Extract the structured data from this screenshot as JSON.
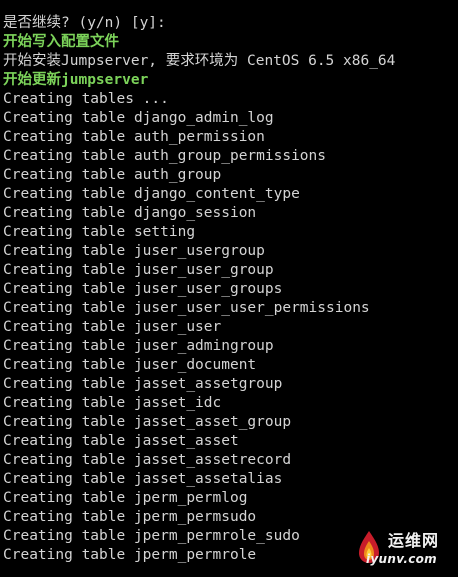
{
  "terminal": {
    "lines": [
      {
        "text": "是否继续? (y/n) [y]:",
        "style": "normal"
      },
      {
        "text": "开始写入配置文件",
        "style": "green"
      },
      {
        "text": "开始安装Jumpserver, 要求环境为 CentOS 6.5 x86_64",
        "style": "normal"
      },
      {
        "text": "开始更新jumpserver",
        "style": "green"
      },
      {
        "text": "Creating tables ...",
        "style": "normal"
      },
      {
        "text": "Creating table django_admin_log",
        "style": "normal"
      },
      {
        "text": "Creating table auth_permission",
        "style": "normal"
      },
      {
        "text": "Creating table auth_group_permissions",
        "style": "normal"
      },
      {
        "text": "Creating table auth_group",
        "style": "normal"
      },
      {
        "text": "Creating table django_content_type",
        "style": "normal"
      },
      {
        "text": "Creating table django_session",
        "style": "normal"
      },
      {
        "text": "Creating table setting",
        "style": "normal"
      },
      {
        "text": "Creating table juser_usergroup",
        "style": "normal"
      },
      {
        "text": "Creating table juser_user_group",
        "style": "normal"
      },
      {
        "text": "Creating table juser_user_groups",
        "style": "normal"
      },
      {
        "text": "Creating table juser_user_user_permissions",
        "style": "normal"
      },
      {
        "text": "Creating table juser_user",
        "style": "normal"
      },
      {
        "text": "Creating table juser_admingroup",
        "style": "normal"
      },
      {
        "text": "Creating table juser_document",
        "style": "normal"
      },
      {
        "text": "Creating table jasset_assetgroup",
        "style": "normal"
      },
      {
        "text": "Creating table jasset_idc",
        "style": "normal"
      },
      {
        "text": "Creating table jasset_asset_group",
        "style": "normal"
      },
      {
        "text": "Creating table jasset_asset",
        "style": "normal"
      },
      {
        "text": "Creating table jasset_assetrecord",
        "style": "normal"
      },
      {
        "text": "Creating table jasset_assetalias",
        "style": "normal"
      },
      {
        "text": "Creating table jperm_permlog",
        "style": "normal"
      },
      {
        "text": "Creating table jperm_permsudo",
        "style": "normal"
      },
      {
        "text": "Creating table jperm_permrole_sudo",
        "style": "normal"
      },
      {
        "text": "Creating table jperm_permrole",
        "style": "normal"
      }
    ]
  },
  "watermark": {
    "name": "运维网",
    "url": "iyunv.com",
    "logo_icon": "flame-drop-icon"
  },
  "colors": {
    "background": "#000000",
    "text": "#d4d4d4",
    "highlight": "#7cd35a"
  }
}
